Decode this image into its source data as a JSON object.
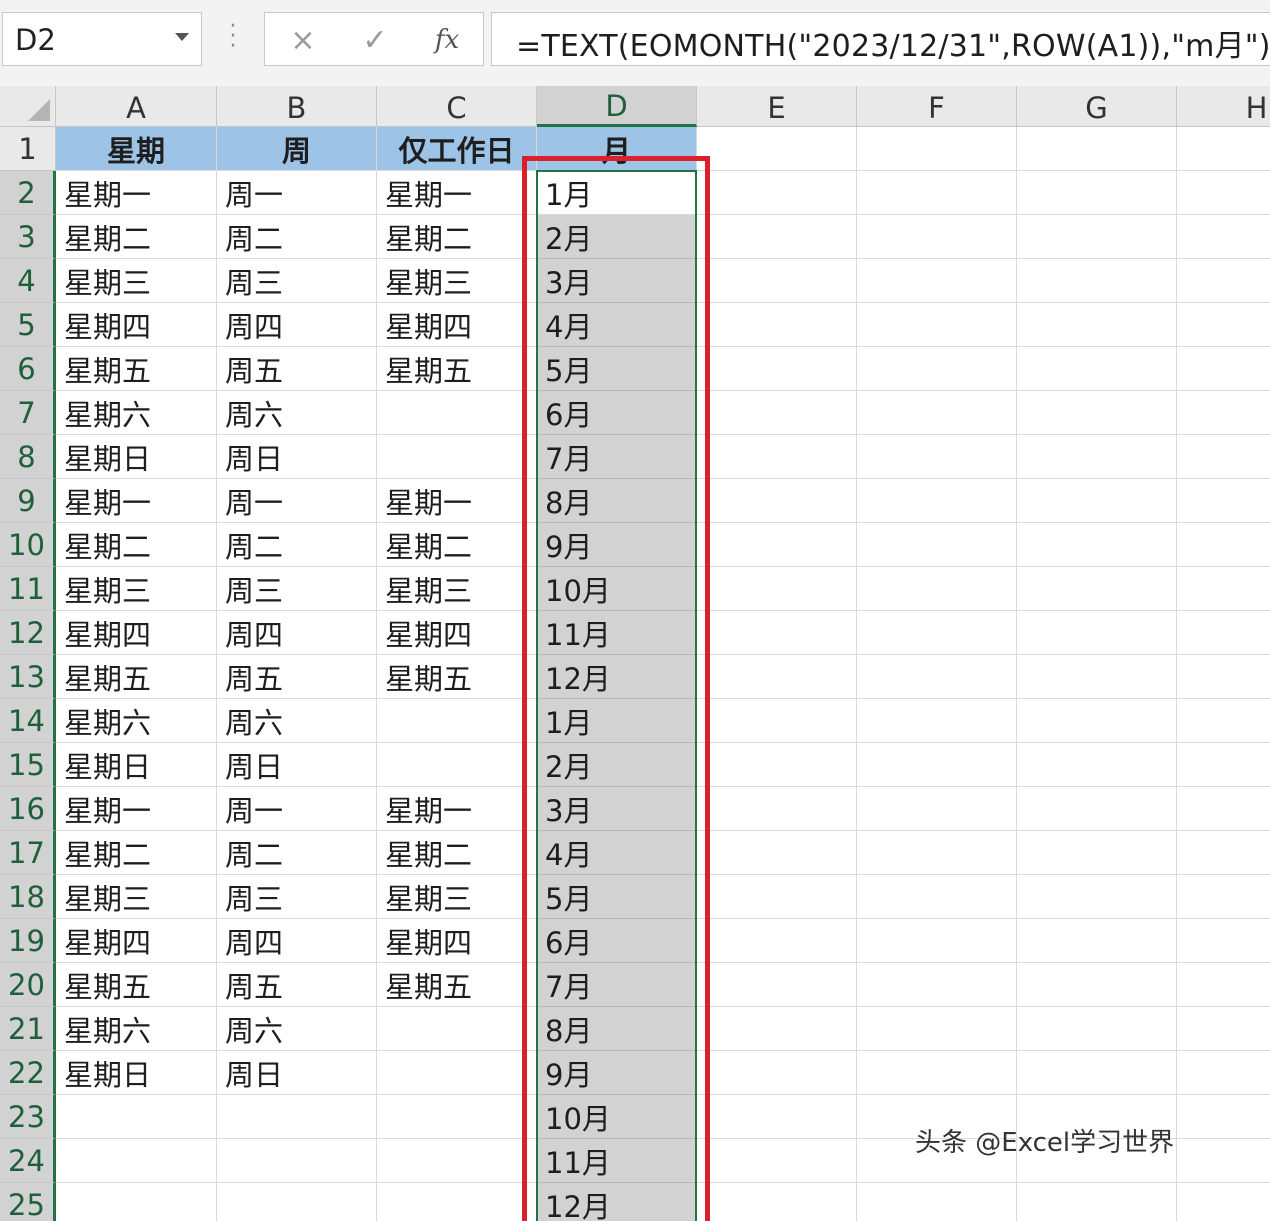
{
  "formula_bar": {
    "name_box": "D2",
    "cancel_icon": "×",
    "enter_icon": "✓",
    "fx_label": "fx",
    "formula": "=TEXT(EOMONTH(\"2023/12/31\",ROW(A1)),\"m月\")"
  },
  "columns": [
    "A",
    "B",
    "C",
    "D",
    "E",
    "F",
    "G",
    "H"
  ],
  "rows": [
    "1",
    "2",
    "3",
    "4",
    "5",
    "6",
    "7",
    "8",
    "9",
    "10",
    "11",
    "12",
    "13",
    "14",
    "15",
    "16",
    "17",
    "18",
    "19",
    "20",
    "21",
    "22",
    "23",
    "24",
    "25"
  ],
  "header_row": [
    "星期",
    "周",
    "仅工作日",
    "月"
  ],
  "table": [
    [
      "星期一",
      "周一",
      "星期一",
      "1月"
    ],
    [
      "星期二",
      "周二",
      "星期二",
      "2月"
    ],
    [
      "星期三",
      "周三",
      "星期三",
      "3月"
    ],
    [
      "星期四",
      "周四",
      "星期四",
      "4月"
    ],
    [
      "星期五",
      "周五",
      "星期五",
      "5月"
    ],
    [
      "星期六",
      "周六",
      "",
      "6月"
    ],
    [
      "星期日",
      "周日",
      "",
      "7月"
    ],
    [
      "星期一",
      "周一",
      "星期一",
      "8月"
    ],
    [
      "星期二",
      "周二",
      "星期二",
      "9月"
    ],
    [
      "星期三",
      "周三",
      "星期三",
      "10月"
    ],
    [
      "星期四",
      "周四",
      "星期四",
      "11月"
    ],
    [
      "星期五",
      "周五",
      "星期五",
      "12月"
    ],
    [
      "星期六",
      "周六",
      "",
      "1月"
    ],
    [
      "星期日",
      "周日",
      "",
      "2月"
    ],
    [
      "星期一",
      "周一",
      "星期一",
      "3月"
    ],
    [
      "星期二",
      "周二",
      "星期二",
      "4月"
    ],
    [
      "星期三",
      "周三",
      "星期三",
      "5月"
    ],
    [
      "星期四",
      "周四",
      "星期四",
      "6月"
    ],
    [
      "星期五",
      "周五",
      "星期五",
      "7月"
    ],
    [
      "星期六",
      "周六",
      "",
      "8月"
    ],
    [
      "星期日",
      "周日",
      "",
      "9月"
    ],
    [
      "",
      "",
      "",
      "10月"
    ],
    [
      "",
      "",
      "",
      "11月"
    ],
    [
      "",
      "",
      "",
      "12月"
    ]
  ],
  "watermark": "头条 @Excel学习世界",
  "colors": {
    "header_fill": "#9dc3e6",
    "selection_fill": "#d2d2d2",
    "accent_green": "#217346",
    "highlight_red": "#d9202b"
  }
}
